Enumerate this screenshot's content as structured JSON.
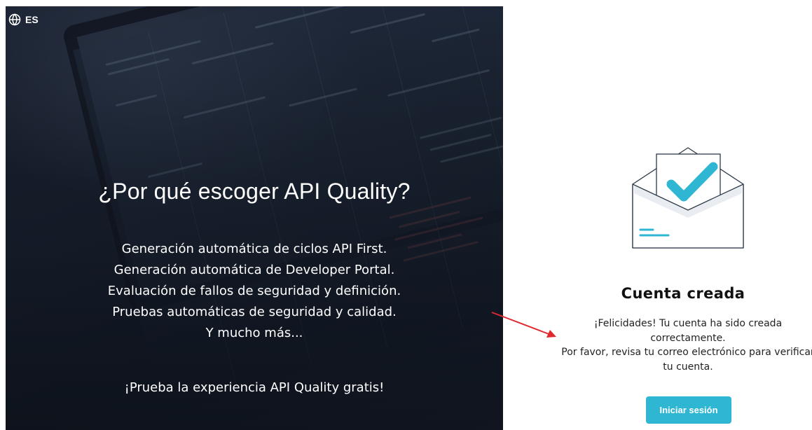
{
  "language": {
    "code": "ES",
    "icon": "globe-icon"
  },
  "hero": {
    "title": "¿Por qué escoger API Quality?",
    "features": [
      "Generación automática de ciclos API First.",
      "Generación automática de Developer Portal.",
      "Evaluación de fallos de seguridad y definición.",
      "Pruebas automáticas de seguridad y calidad.",
      "Y mucho más..."
    ],
    "cta": "¡Prueba la experiencia API Quality gratis!"
  },
  "confirmation": {
    "icon": "envelope-check-icon",
    "title": "Cuenta creada",
    "message_line1": "¡Felicidades! Tu cuenta ha sido creada correctamente.",
    "message_line2": "Por favor, revisa tu correo electrónico para verificar tu cuenta.",
    "button_label": "Iniciar sesión"
  },
  "colors": {
    "accent": "#2fb6d3",
    "annotation_arrow": "#e0282e",
    "hero_overlay": "#1c2536"
  }
}
